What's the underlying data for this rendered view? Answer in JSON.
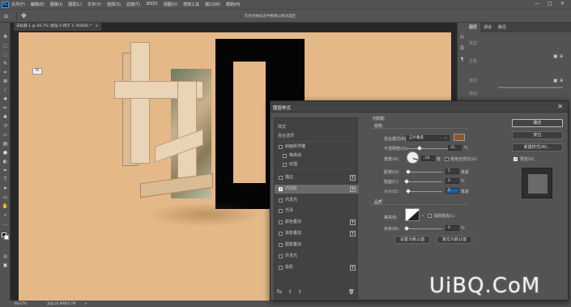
{
  "menubar": {
    "logo": "Ps",
    "items": [
      "文件(F)",
      "编辑(E)",
      "图像(I)",
      "图层(L)",
      "文字(Y)",
      "选择(S)",
      "滤镜(T)",
      "3D(D)",
      "视图(V)",
      "增效工具",
      "窗口(W)",
      "帮助(H)"
    ],
    "window_controls": [
      "—",
      "□",
      "✕"
    ]
  },
  "options_bar": {
    "home_icon": "home-icon",
    "move_icon": "move-icon",
    "hint": "在仿开始标志中拖移以移动选区"
  },
  "document_tab": {
    "label": "未标题-1 @ 66.7% (图层 0 拷贝 3, RGB/8) *",
    "close": "×"
  },
  "canvas": {
    "background_color": "#e4b887",
    "tooltip": "AI"
  },
  "status_bar": {
    "zoom": "66.67%",
    "doc_info": "文档:24.9M/65.7M",
    "arrow": ">"
  },
  "right_panel": {
    "tabs": [
      "图层",
      "通道",
      "路径"
    ],
    "rows": [
      "类型",
      "正常",
      "锁定:",
      "填充:",
      "不透明度:"
    ]
  },
  "watermark": "UiBQ.CoM",
  "dialog": {
    "title": "图层样式",
    "close": "✕",
    "list": [
      {
        "label": "样式",
        "checkbox": false,
        "checked": false,
        "plus": false,
        "selected": false
      },
      {
        "label": "混合选项",
        "checkbox": false,
        "checked": false,
        "plus": false,
        "selected": false
      },
      {
        "label": "斜面和浮雕",
        "checkbox": true,
        "checked": false,
        "plus": false,
        "selected": false
      },
      {
        "label": "等高线",
        "checkbox": true,
        "checked": false,
        "plus": false,
        "selected": false,
        "indent": true
      },
      {
        "label": "纹理",
        "checkbox": true,
        "checked": false,
        "plus": false,
        "selected": false,
        "indent": true
      },
      {
        "label": "描边",
        "checkbox": true,
        "checked": false,
        "plus": true,
        "selected": false
      },
      {
        "label": "内阴影",
        "checkbox": true,
        "checked": true,
        "plus": true,
        "selected": true
      },
      {
        "label": "内发光",
        "checkbox": true,
        "checked": false,
        "plus": false,
        "selected": false
      },
      {
        "label": "光泽",
        "checkbox": true,
        "checked": false,
        "plus": false,
        "selected": false
      },
      {
        "label": "颜色叠加",
        "checkbox": true,
        "checked": false,
        "plus": true,
        "selected": false
      },
      {
        "label": "渐变叠加",
        "checkbox": true,
        "checked": false,
        "plus": true,
        "selected": false
      },
      {
        "label": "图案叠加",
        "checkbox": true,
        "checked": false,
        "plus": false,
        "selected": false
      },
      {
        "label": "外发光",
        "checkbox": true,
        "checked": false,
        "plus": false,
        "selected": false
      },
      {
        "label": "投影",
        "checkbox": true,
        "checked": false,
        "plus": true,
        "selected": false
      }
    ],
    "list_footer": [
      "fx.",
      "⇧",
      "⇩",
      "🗑"
    ],
    "section_title": "内阴影",
    "structure_title": "结构",
    "blend_mode_label": "混合模式(B):",
    "blend_mode_value": "正片叠底",
    "shadow_color": "#8a5a2a",
    "opacity_label": "不透明度(O):",
    "opacity_value": "31",
    "opacity_fraction": 0.31,
    "angle_label": "角度(A):",
    "angle_value": "-16",
    "angle_unit": "度",
    "global_light_label": "使用全局光(G)",
    "distance_label": "距离(D):",
    "distance_value": "5",
    "distance_fraction": 0.05,
    "choke_label": "阻塞(C):",
    "choke_value": "0",
    "choke_fraction": 0.0,
    "size_label": "大小(S):",
    "size_value": "5",
    "size_fraction": 0.05,
    "unit_px": "像素",
    "unit_pct": "%",
    "quality_title": "品质",
    "contour_label": "等高线:",
    "antialias_label": "消除锯齿(L)",
    "noise_label": "杂色(N):",
    "noise_value": "0",
    "noise_fraction": 0.0,
    "btn_set_default": "设置为默认值",
    "btn_reset_default": "复位为默认值",
    "btn_ok": "确定",
    "btn_cancel": "复位",
    "btn_new_style": "新建样式(W)...",
    "preview_label": "预览(V)",
    "preview_checked": true
  }
}
